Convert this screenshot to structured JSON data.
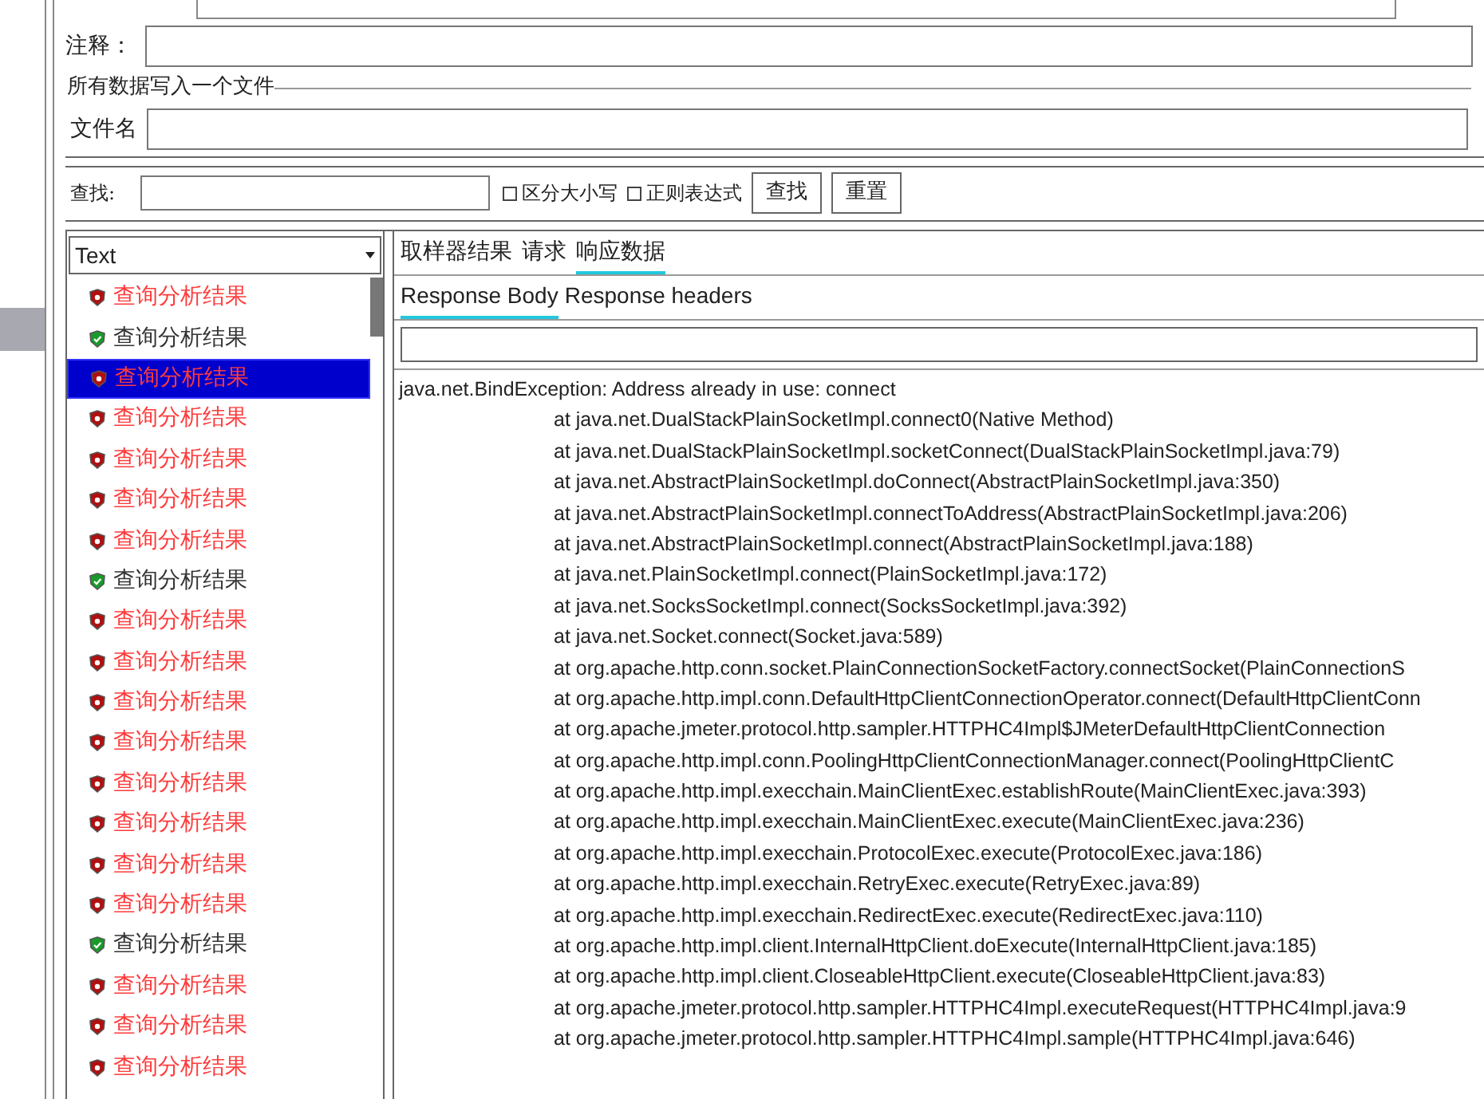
{
  "form": {
    "comment_label": "注释：",
    "fieldset_title": "所有数据写入一个文件",
    "filename_label": "文件名"
  },
  "search": {
    "label": "查找:",
    "case_sensitive": {
      "label": "区分大小写",
      "checked": false
    },
    "regex": {
      "label": "正则表达式",
      "checked": false
    },
    "find_button": "查找",
    "reset_button": "重置"
  },
  "renderer": {
    "value": "Text"
  },
  "results": [
    {
      "label": "查询分析结果",
      "success": false,
      "selected": false
    },
    {
      "label": "查询分析结果",
      "success": true,
      "selected": false
    },
    {
      "label": "查询分析结果",
      "success": false,
      "selected": true
    },
    {
      "label": "查询分析结果",
      "success": false,
      "selected": false
    },
    {
      "label": "查询分析结果",
      "success": false,
      "selected": false
    },
    {
      "label": "查询分析结果",
      "success": false,
      "selected": false
    },
    {
      "label": "查询分析结果",
      "success": false,
      "selected": false
    },
    {
      "label": "查询分析结果",
      "success": true,
      "selected": false
    },
    {
      "label": "查询分析结果",
      "success": false,
      "selected": false
    },
    {
      "label": "查询分析结果",
      "success": false,
      "selected": false
    },
    {
      "label": "查询分析结果",
      "success": false,
      "selected": false
    },
    {
      "label": "查询分析结果",
      "success": false,
      "selected": false
    },
    {
      "label": "查询分析结果",
      "success": false,
      "selected": false
    },
    {
      "label": "查询分析结果",
      "success": false,
      "selected": false
    },
    {
      "label": "查询分析结果",
      "success": false,
      "selected": false
    },
    {
      "label": "查询分析结果",
      "success": false,
      "selected": false
    },
    {
      "label": "查询分析结果",
      "success": true,
      "selected": false
    },
    {
      "label": "查询分析结果",
      "success": false,
      "selected": false
    },
    {
      "label": "查询分析结果",
      "success": false,
      "selected": false
    },
    {
      "label": "查询分析结果",
      "success": false,
      "selected": false
    }
  ],
  "tabs": [
    {
      "label": "取样器结果",
      "selected": false
    },
    {
      "label": "请求",
      "selected": false
    },
    {
      "label": "响应数据",
      "selected": true
    }
  ],
  "subtabs": [
    {
      "label": "Response Body",
      "selected": true
    },
    {
      "label": "Response headers",
      "selected": false
    }
  ],
  "response_body": [
    {
      "kind": "head",
      "text": "java.net.BindException: Address already in use: connect"
    },
    {
      "kind": "frame",
      "text": "at java.net.DualStackPlainSocketImpl.connect0(Native Method)"
    },
    {
      "kind": "frame",
      "text": "at java.net.DualStackPlainSocketImpl.socketConnect(DualStackPlainSocketImpl.java:79)"
    },
    {
      "kind": "frame",
      "text": "at java.net.AbstractPlainSocketImpl.doConnect(AbstractPlainSocketImpl.java:350)"
    },
    {
      "kind": "frame",
      "text": "at java.net.AbstractPlainSocketImpl.connectToAddress(AbstractPlainSocketImpl.java:206)"
    },
    {
      "kind": "frame",
      "text": "at java.net.AbstractPlainSocketImpl.connect(AbstractPlainSocketImpl.java:188)"
    },
    {
      "kind": "frame",
      "text": "at java.net.PlainSocketImpl.connect(PlainSocketImpl.java:172)"
    },
    {
      "kind": "frame",
      "text": "at java.net.SocksSocketImpl.connect(SocksSocketImpl.java:392)"
    },
    {
      "kind": "frame",
      "text": "at java.net.Socket.connect(Socket.java:589)"
    },
    {
      "kind": "frame",
      "text": "at org.apache.http.conn.socket.PlainConnectionSocketFactory.connectSocket(PlainConnectionS"
    },
    {
      "kind": "frame",
      "text": "at org.apache.http.impl.conn.DefaultHttpClientConnectionOperator.connect(DefaultHttpClientConn"
    },
    {
      "kind": "frame",
      "text": "at org.apache.jmeter.protocol.http.sampler.HTTPHC4Impl$JMeterDefaultHttpClientConnection"
    },
    {
      "kind": "frame",
      "text": "at org.apache.http.impl.conn.PoolingHttpClientConnectionManager.connect(PoolingHttpClientC"
    },
    {
      "kind": "frame",
      "text": "at org.apache.http.impl.execchain.MainClientExec.establishRoute(MainClientExec.java:393)"
    },
    {
      "kind": "frame",
      "text": "at org.apache.http.impl.execchain.MainClientExec.execute(MainClientExec.java:236)"
    },
    {
      "kind": "frame",
      "text": "at org.apache.http.impl.execchain.ProtocolExec.execute(ProtocolExec.java:186)"
    },
    {
      "kind": "frame",
      "text": "at org.apache.http.impl.execchain.RetryExec.execute(RetryExec.java:89)"
    },
    {
      "kind": "frame",
      "text": "at org.apache.http.impl.execchain.RedirectExec.execute(RedirectExec.java:110)"
    },
    {
      "kind": "frame",
      "text": "at org.apache.http.impl.client.InternalHttpClient.doExecute(InternalHttpClient.java:185)"
    },
    {
      "kind": "frame",
      "text": "at org.apache.http.impl.client.CloseableHttpClient.execute(CloseableHttpClient.java:83)"
    },
    {
      "kind": "frame",
      "text": "at org.apache.jmeter.protocol.http.sampler.HTTPHC4Impl.executeRequest(HTTPHC4Impl.java:9"
    },
    {
      "kind": "frame",
      "text": "at org.apache.jmeter.protocol.http.sampler.HTTPHC4Impl.sample(HTTPHC4Impl.java:646)"
    }
  ]
}
